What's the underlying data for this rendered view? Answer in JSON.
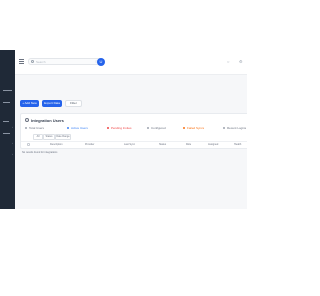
{
  "header": {
    "search_placeholder": "Search",
    "avatar_initial": "U",
    "right_icons": [
      "bell-icon",
      "settings-icon"
    ]
  },
  "sidebar": {
    "items": [
      {
        "icon": "dashboard-icon"
      },
      {
        "icon": "users-icon"
      },
      {
        "icon": "folder-icon"
      },
      {
        "icon": "settings-icon"
      },
      {
        "icon": "chart-icon"
      }
    ]
  },
  "toolbar": {
    "new_label": "+ Add New",
    "export_label": "Export Data",
    "filter_label": "Filter"
  },
  "card": {
    "title": "Integration Users",
    "stats": [
      {
        "label": "Total Users",
        "color": "#9ca3af"
      },
      {
        "label": "Active Users",
        "color": "#3b82f6"
      },
      {
        "label": "Pending Invites",
        "color": "#ef4444"
      },
      {
        "label": "Configured",
        "color": "#9ca3af"
      },
      {
        "label": "Failed Syncs",
        "color": "#f97316"
      },
      {
        "label": "Recent Logins",
        "color": "#9ca3af"
      }
    ],
    "filters": [
      "All",
      "Status",
      "Date Range"
    ],
    "columns": [
      "Description",
      "Provider",
      "Last Sync",
      "Status",
      "Role",
      "Assigned",
      "Health"
    ],
    "empty_text": "No results found for integrations"
  }
}
